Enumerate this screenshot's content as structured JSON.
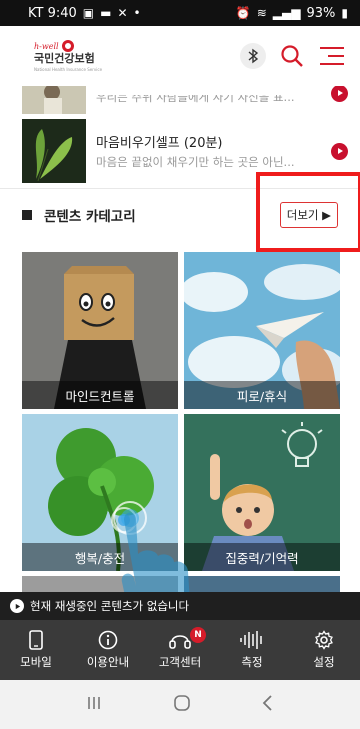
{
  "status_bar": {
    "time_carrier": "KT 9:40",
    "battery": "93%"
  },
  "header": {
    "logo_brand": "h-well",
    "logo_name": "국민건강보험",
    "logo_sub": "National Health Insurance Service",
    "icons": [
      "bluetooth-icon",
      "search-icon",
      "menu-icon"
    ]
  },
  "list_items": [
    {
      "title": "",
      "desc": "우리는 주위 사람들에게 자기 자신을 표..."
    },
    {
      "title": "마음비우기셀프 (20분)",
      "desc": "마음은 끝없이 채우기만 하는 곳은 아닌..."
    }
  ],
  "section": {
    "title": "콘텐츠 카테고리",
    "more_label": "더보기 ▶"
  },
  "categories": [
    {
      "label": "마인드컨트롤"
    },
    {
      "label": "피로/휴식"
    },
    {
      "label": "행복/충전"
    },
    {
      "label": "집중력/기억력"
    }
  ],
  "now_playing": {
    "text": "현재 재생중인 콘텐츠가 없습니다"
  },
  "bottom_nav": [
    {
      "label": "모바일",
      "icon": "mobile-icon"
    },
    {
      "label": "이용안내",
      "icon": "info-icon"
    },
    {
      "label": "고객센터",
      "icon": "headset-icon",
      "badge": "N"
    },
    {
      "label": "측정",
      "icon": "waveform-icon"
    },
    {
      "label": "설정",
      "icon": "gear-icon"
    }
  ],
  "colors": {
    "brand_red": "#d51c2a",
    "nav_bg": "#3a3a3a",
    "highlight": "#ef1c1c"
  }
}
